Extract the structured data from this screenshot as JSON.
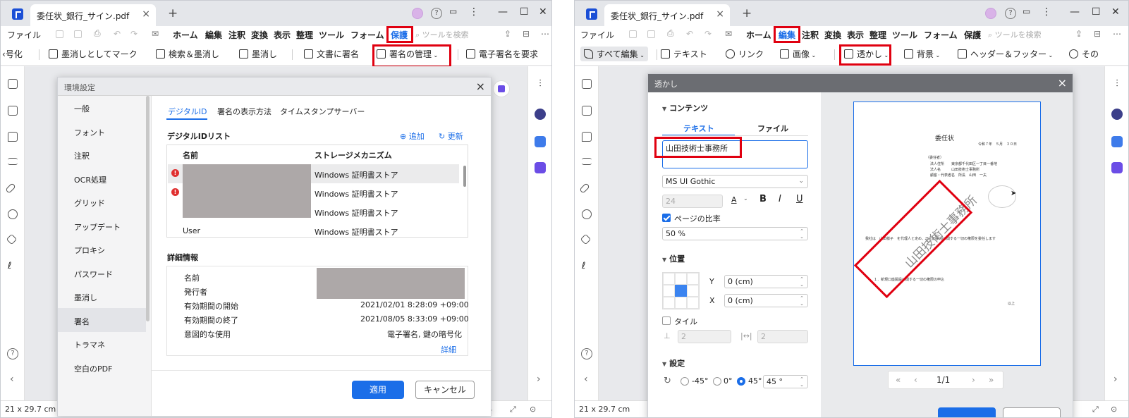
{
  "left": {
    "tab_title": "委任状_銀行_サイン.pdf",
    "menu": {
      "file": "ファイル",
      "items": [
        "ホーム",
        "編集",
        "注釈",
        "変換",
        "表示",
        "整理",
        "ツール",
        "フォーム",
        "保護"
      ],
      "active": "保護",
      "search_placeholder": "ツールを検索"
    },
    "toolbar": [
      "号化",
      "墨消しとしてマーク",
      "検索＆墨消し",
      "墨消し",
      "文書に署名",
      "署名の管理",
      "電子署名を要求"
    ],
    "status_size": "21 x 29.7 cm",
    "dialog": {
      "title": "環境設定",
      "nav": [
        "一般",
        "フォント",
        "注釈",
        "OCR処理",
        "グリッド",
        "アップデート",
        "プロキシ",
        "パスワード",
        "墨消し",
        "署名",
        "トラマネ",
        "空白のPDF"
      ],
      "nav_selected": "署名",
      "subtabs": [
        "デジタルID",
        "署名の表示方法",
        "タイムスタンプサーバー"
      ],
      "list_heading": "デジタルIDリスト",
      "add": "追加",
      "refresh": "更新",
      "columns": [
        "名前",
        "ストレージメカニズム"
      ],
      "rows": [
        {
          "name": "",
          "storage": "Windows 証明書ストア",
          "error": true
        },
        {
          "name": "",
          "storage": "Windows 証明書ストア",
          "error": true
        },
        {
          "name": "",
          "storage": "Windows 証明書ストア",
          "error": false
        },
        {
          "name": "User",
          "storage": "Windows 証明書ストア",
          "error": false
        }
      ],
      "detail_heading": "詳細情報",
      "details": [
        {
          "label": "名前",
          "value": ""
        },
        {
          "label": "発行者",
          "value": ""
        },
        {
          "label": "有効期間の開始",
          "value": "2021/02/01 8:28:09 +09:00"
        },
        {
          "label": "有効期間の終了",
          "value": "2021/08/05 8:33:09 +09:00"
        },
        {
          "label": "意図的な使用",
          "value": "電子署名, 鍵の暗号化"
        }
      ],
      "detail_link": "詳細",
      "apply": "適用",
      "cancel": "キャンセル"
    }
  },
  "right": {
    "tab_title": "委任状_銀行_サイン.pdf",
    "menu": {
      "file": "ファイル",
      "items": [
        "ホーム",
        "編集",
        "注釈",
        "変換",
        "表示",
        "整理",
        "ツール",
        "フォーム",
        "保護"
      ],
      "active": "編集",
      "search_placeholder": "ツールを検索"
    },
    "toolbar": [
      "すべて編集",
      "テキスト",
      "リンク",
      "画像",
      "透かし",
      "背景",
      "ヘッダー＆フッター",
      "その"
    ],
    "status_size": "21 x 29.7 cm",
    "dialog": {
      "title": "透かし",
      "content_heading": "コンテンツ",
      "subtabs": [
        "テキスト",
        "ファイル"
      ],
      "text_value": "山田技術士事務所",
      "font": "MS UI Gothic",
      "font_size": "24",
      "ratio_label": "ページの比率",
      "ratio_checked": true,
      "ratio_value": "50 %",
      "position_heading": "位置",
      "y_label": "Y",
      "y_value": "0 (cm)",
      "x_label": "X",
      "x_value": "0 (cm)",
      "tile_label": "タイル",
      "tile_v": "2",
      "tile_h": "2",
      "settings_heading": "設定",
      "angles": [
        "-45°",
        "0°",
        "45°"
      ],
      "angle_selected": "45°",
      "angle_value": "45 °",
      "pager": "1/1",
      "preview": {
        "doc_title": "委任状",
        "date": "令和７年　５月　３０日",
        "lines": [
          "（委任者）",
          "法人住所　　東京都千代田区一丁目一番地",
          "法人名　　　山田技術士事務所",
          "顧客・代表者名　所長　山田　一夫"
        ],
        "body": "我社は　山田様子　を代理人と定め、下記の事項に関する一切の権限を委任します",
        "item": "１．新規口座開設に関する一切の権限の申込",
        "end": "以上",
        "watermark": "山田技術士事務所"
      }
    }
  },
  "colors": {
    "accent": "#1b6ee8",
    "highlight": "#e00010"
  }
}
